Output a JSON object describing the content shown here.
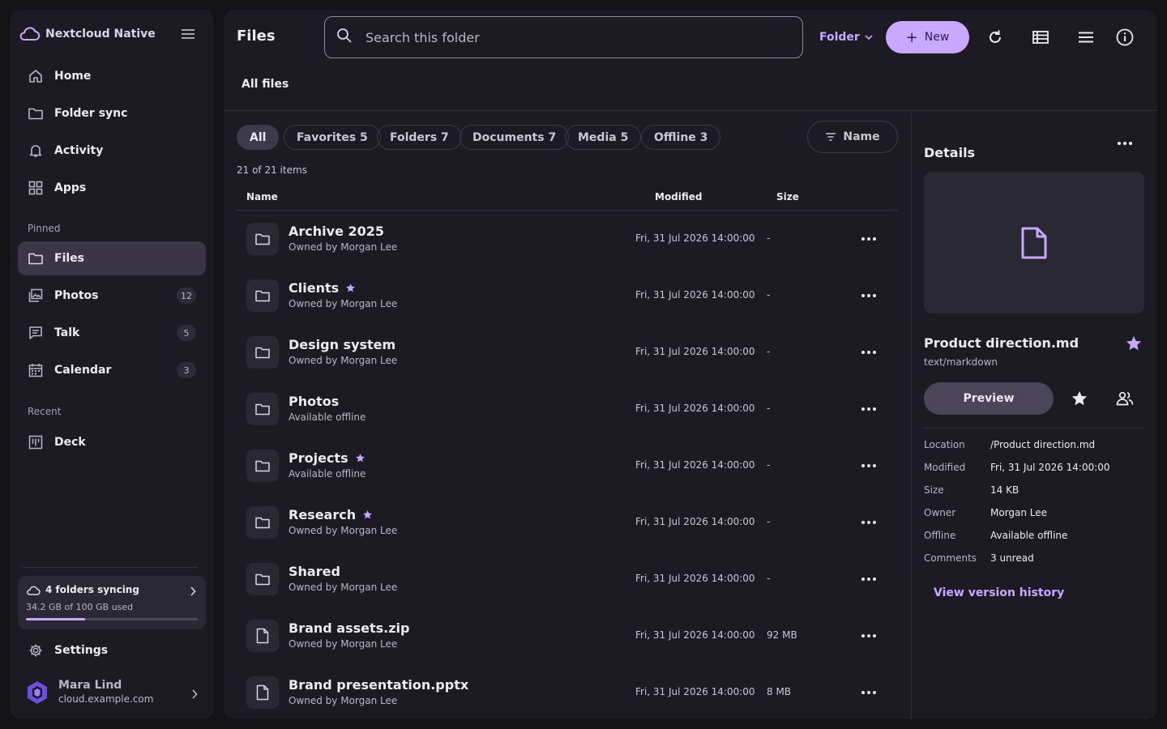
{
  "app": {
    "name": "Nextcloud Native"
  },
  "sidebar": {
    "items": [
      {
        "label": "Home",
        "icon": "home-icon"
      },
      {
        "label": "Folder sync",
        "icon": "folder-icon"
      },
      {
        "label": "Activity",
        "icon": "bell-icon"
      },
      {
        "label": "Apps",
        "icon": "grid-icon"
      }
    ],
    "pinned_label": "Pinned",
    "pinned": [
      {
        "label": "Files",
        "icon": "folder-icon",
        "active": true,
        "badge": ""
      },
      {
        "label": "Photos",
        "icon": "photos-icon",
        "badge": "12"
      },
      {
        "label": "Talk",
        "icon": "chat-icon",
        "badge": "5"
      },
      {
        "label": "Calendar",
        "icon": "calendar-icon",
        "badge": "3"
      }
    ],
    "recent_label": "Recent",
    "recent": [
      {
        "label": "Deck",
        "icon": "deck-icon"
      }
    ],
    "sync": {
      "title": "4 folders syncing",
      "usage": "34.2 GB of 100 GB used",
      "fraction": 0.342
    },
    "settings_label": "Settings",
    "user": {
      "name": "Mara Lind",
      "host": "cloud.example.com"
    }
  },
  "header": {
    "title": "Files",
    "search_placeholder": "Search this folder",
    "folder_dropdown": "Folder",
    "new_label": "New",
    "breadcrumb": "All files"
  },
  "filters": {
    "chips": [
      "All",
      "Favorites 5",
      "Folders 7",
      "Documents 7",
      "Media 5",
      "Offline 3"
    ],
    "active_index": 0,
    "sort_label": "Name"
  },
  "list": {
    "count": "21 of 21 items",
    "columns": {
      "name": "Name",
      "modified": "Modified",
      "size": "Size"
    },
    "rows": [
      {
        "name": "Archive 2025",
        "sub": "Owned by Morgan Lee",
        "modified": "Fri, 31 Jul 2026 14:00:00",
        "size": "-",
        "type": "folder",
        "starred": false
      },
      {
        "name": "Clients",
        "sub": "Owned by Morgan Lee",
        "modified": "Fri, 31 Jul 2026 14:00:00",
        "size": "-",
        "type": "folder",
        "starred": true
      },
      {
        "name": "Design system",
        "sub": "Owned by Morgan Lee",
        "modified": "Fri, 31 Jul 2026 14:00:00",
        "size": "-",
        "type": "folder",
        "starred": false
      },
      {
        "name": "Photos",
        "sub": "Available offline",
        "modified": "Fri, 31 Jul 2026 14:00:00",
        "size": "-",
        "type": "folder",
        "starred": false
      },
      {
        "name": "Projects",
        "sub": "Available offline",
        "modified": "Fri, 31 Jul 2026 14:00:00",
        "size": "-",
        "type": "folder",
        "starred": true
      },
      {
        "name": "Research",
        "sub": "Owned by Morgan Lee",
        "modified": "Fri, 31 Jul 2026 14:00:00",
        "size": "-",
        "type": "folder",
        "starred": true
      },
      {
        "name": "Shared",
        "sub": "Owned by Morgan Lee",
        "modified": "Fri, 31 Jul 2026 14:00:00",
        "size": "-",
        "type": "folder",
        "starred": false
      },
      {
        "name": "Brand assets.zip",
        "sub": "Owned by Morgan Lee",
        "modified": "Fri, 31 Jul 2026 14:00:00",
        "size": "92 MB",
        "type": "file",
        "starred": false
      },
      {
        "name": "Brand presentation.pptx",
        "sub": "Owned by Morgan Lee",
        "modified": "Fri, 31 Jul 2026 14:00:00",
        "size": "8 MB",
        "type": "file",
        "starred": false
      }
    ]
  },
  "details": {
    "title": "Details",
    "file_name": "Product direction.md",
    "mime": "text/markdown",
    "preview_label": "Preview",
    "meta": [
      {
        "key": "Location",
        "value": "/Product direction.md"
      },
      {
        "key": "Modified",
        "value": "Fri, 31 Jul 2026 14:00:00"
      },
      {
        "key": "Size",
        "value": "14 KB"
      },
      {
        "key": "Owner",
        "value": "Morgan Lee"
      },
      {
        "key": "Offline",
        "value": "Available offline"
      },
      {
        "key": "Comments",
        "value": "3 unread"
      }
    ],
    "version_history": "View version history"
  },
  "colors": {
    "accent": "#c9a9ff",
    "background": "#121217",
    "panel": "#1c1b23"
  }
}
